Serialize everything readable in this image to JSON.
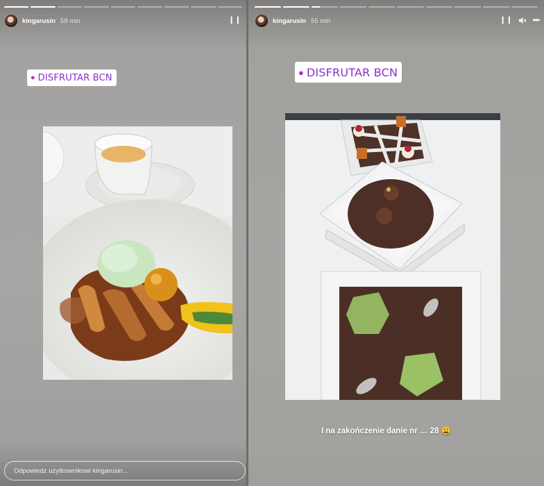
{
  "stories": [
    {
      "username": "kingarusin",
      "time": "58 min",
      "location": "DISFRUTAR BCN",
      "progress_segments": [
        1,
        1,
        0,
        0,
        0,
        0,
        0,
        0,
        0
      ],
      "reply_placeholder": "Odpowiedz użytkownikowi kingarusin..."
    },
    {
      "username": "kingarusin",
      "time": "55 min",
      "location": "DISFRUTAR BCN",
      "progress_segments": [
        1,
        1,
        0.3,
        0,
        0,
        0,
        0,
        0,
        0,
        0
      ],
      "caption": "I na zakończenie danie nr … 28 😩"
    }
  ],
  "icons": {
    "pause": "⏸",
    "mute": "🔈",
    "more": "⋯",
    "location_pin": "📍"
  }
}
